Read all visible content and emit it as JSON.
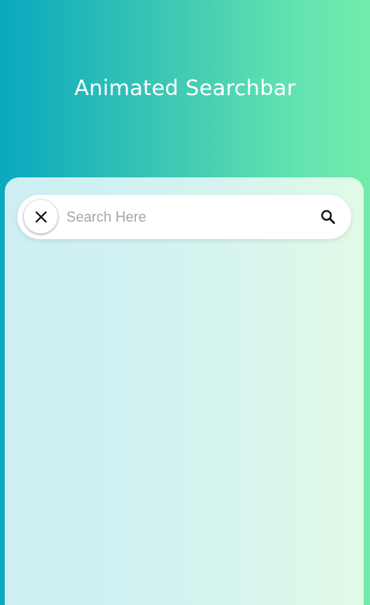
{
  "header": {
    "title": "Animated Searchbar"
  },
  "search": {
    "placeholder": "Search Here",
    "value": "",
    "close_icon": "close-icon",
    "search_icon": "search-icon"
  },
  "colors": {
    "background_start": "#0aa8bf",
    "background_end": "#72ecab",
    "title_text": "#ffffff",
    "placeholder_text": "#a7a7a7",
    "panel": "#d3f3f1"
  }
}
